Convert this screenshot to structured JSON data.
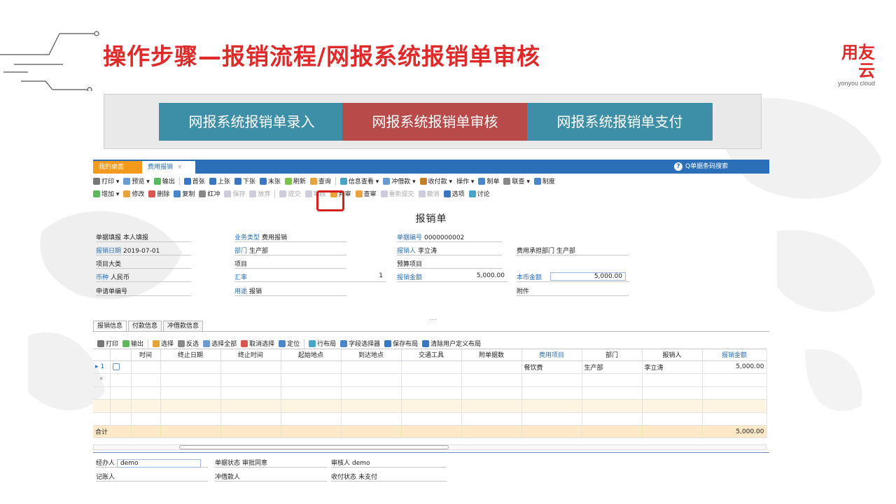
{
  "slide": {
    "title": "操作步骤—报销流程/网报系统报销单审核",
    "brand_main": "用友云",
    "brand_sub": "yonyou cloud",
    "accent_color": "#e02a2a"
  },
  "flow_steps": [
    {
      "label": "网报系统报销单录入",
      "color": "#3d8fa8"
    },
    {
      "label": "网报系统报销单审核",
      "color": "#b84a4a"
    },
    {
      "label": "网报系统报销单支付",
      "color": "#3d8fa8"
    }
  ],
  "app": {
    "tabs": [
      {
        "label": "我的桌面"
      },
      {
        "label": "费用报销",
        "close": "×"
      }
    ],
    "help_icon": "?",
    "search_placeholder": "Q单据条码搜索",
    "toolbar1": [
      "打印 ▾",
      "预览 ▾",
      "输出",
      "首张",
      "上张",
      "下张",
      "末张",
      "刷新",
      "查询",
      "信息查看 ▾",
      "冲借款 ▾",
      "收付款 ▾",
      "操作 ▾",
      "制单",
      "联查 ▾",
      "制度"
    ],
    "toolbar2": [
      "增加 ▾",
      "修改",
      "删除",
      "复制",
      "红冲",
      "保存",
      "放弃",
      "提交",
      "审核",
      "弃审",
      "查审",
      "重新提交",
      "撤消",
      "选项",
      "讨论"
    ],
    "form_title": "报销单",
    "fields": {
      "fill_type_label": "单据填报",
      "fill_type_value": "本人填报",
      "biz_type_label": "业务类型",
      "biz_type_value": "费用报销",
      "doc_no_label": "单据编号",
      "doc_no_value": "0000000002",
      "date_label": "报销日期",
      "date_value": "2019-07-01",
      "dept_label": "部门",
      "dept_value": "生产部",
      "person_label": "报销人",
      "person_value": "李立涛",
      "cost_dept_label": "费用承担部门",
      "cost_dept_value": "生产部",
      "project_cat_label": "项目大类",
      "project_label": "项目",
      "budget_label": "预算项目",
      "currency_label": "币种",
      "currency_value": "人民币",
      "rate_label": "汇率",
      "rate_value": "1",
      "amount_label": "报销金额",
      "amount_value": "5,000.00",
      "local_amount_label": "本币金额",
      "local_amount_value": "5,000.00",
      "apply_no_label": "申请单编号",
      "purpose_label": "用途",
      "purpose_value": "报销",
      "attach_label": "附件"
    },
    "ellipsis": "....",
    "subtabs": [
      "报销信息",
      "付款信息",
      "冲借款信息"
    ],
    "grid_toolbar": [
      "打印",
      "输出",
      "选择",
      "反选",
      "选择全部",
      "取消选择",
      "定位",
      "行布局",
      "字段选择器",
      "保存布局",
      "清除用户定义布局"
    ],
    "grid": {
      "columns": [
        "",
        "时间",
        "终止日期",
        "终止时间",
        "起始地点",
        "到达地点",
        "交通工具",
        "附单据数",
        "费用项目",
        "部门",
        "报销人",
        "报销金额"
      ],
      "rows": [
        {
          "mark": "▸ 1",
          "cells": [
            "",
            "",
            "",
            "",
            "",
            "",
            "",
            "餐饮费",
            "生产部",
            "李立涛",
            "5,000.00"
          ]
        },
        {
          "mark": "*",
          "cells": [
            "",
            "",
            "",
            "",
            "",
            "",
            "",
            "",
            "",
            "",
            ""
          ]
        }
      ],
      "total_label": "合计",
      "total_value": "5,000.00"
    },
    "footer": {
      "handler_label": "经办人",
      "handler_value": "demo",
      "status_label": "单据状态",
      "status_value": "审批同意",
      "auditor_label": "审核人",
      "auditor_value": "demo",
      "bookkeeper_label": "记账人",
      "offset_label": "冲借款人",
      "pay_status_label": "收付状态",
      "pay_status_value": "未支付"
    }
  }
}
